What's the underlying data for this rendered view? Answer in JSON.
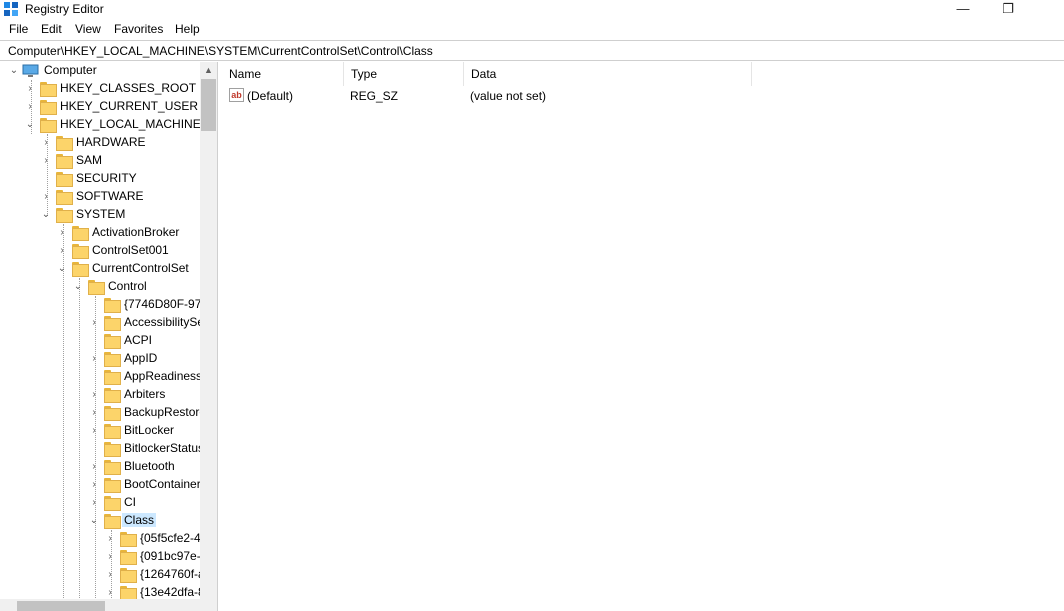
{
  "window": {
    "title": "Registry Editor",
    "minimize_glyph": "—",
    "restore_glyph": "❐"
  },
  "menu": [
    "File",
    "Edit",
    "View",
    "Favorites",
    "Help"
  ],
  "address": "Computer\\HKEY_LOCAL_MACHINE\\SYSTEM\\CurrentControlSet\\Control\\Class",
  "tree": {
    "root": "Computer",
    "hives": {
      "classes_root": "HKEY_CLASSES_ROOT",
      "current_user": "HKEY_CURRENT_USER",
      "local_machine": "HKEY_LOCAL_MACHINE"
    },
    "hklm_children": {
      "hardware": "HARDWARE",
      "sam": "SAM",
      "security": "SECURITY",
      "software": "SOFTWARE",
      "system": "SYSTEM"
    },
    "system_children": {
      "activation_broker": "ActivationBroker",
      "controlset001": "ControlSet001",
      "current_control_set": "CurrentControlSet"
    },
    "control": "Control",
    "control_children": [
      "{7746D80F-97E",
      "AccessibilitySe",
      "ACPI",
      "AppID",
      "AppReadiness",
      "Arbiters",
      "BackupRestore",
      "BitLocker",
      "BitlockerStatus",
      "Bluetooth",
      "BootContainer",
      "CI",
      "Class"
    ],
    "class_children": [
      "{05f5cfe2-4",
      "{091bc97e-",
      "{1264760f-a",
      "{13e42dfa-8"
    ]
  },
  "columns": {
    "name": "Name",
    "type": "Type",
    "data": "Data"
  },
  "values": [
    {
      "icon": "ab",
      "name": "(Default)",
      "type": "REG_SZ",
      "data": "(value not set)"
    }
  ],
  "colors": {
    "selection": "#cce8ff",
    "folder": "#fcd46a"
  }
}
